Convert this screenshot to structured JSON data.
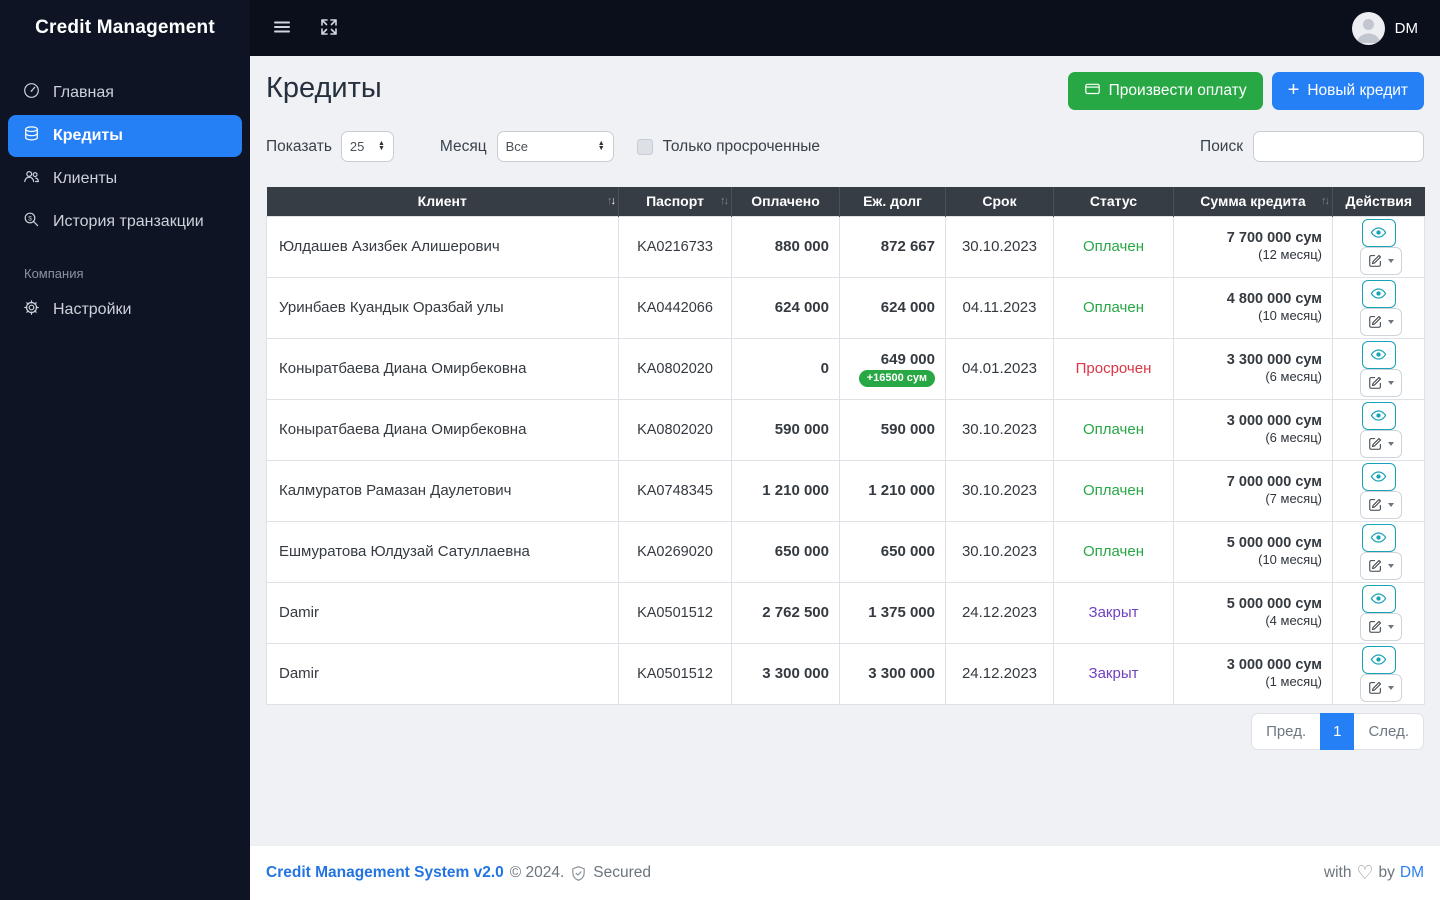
{
  "brand": "Credit Management",
  "topbar": {
    "user_initials": "DM"
  },
  "sidebar": {
    "nav": [
      {
        "label": "Главная",
        "icon": "speedometer-icon",
        "active": false
      },
      {
        "label": "Кредиты",
        "icon": "coins-icon",
        "active": true
      },
      {
        "label": "Клиенты",
        "icon": "users-icon",
        "active": false
      },
      {
        "label": "История транзакции",
        "icon": "transaction-search-icon",
        "active": false
      }
    ],
    "section_label": "Компания",
    "settings_label": "Настройки"
  },
  "page": {
    "title": "Кредиты",
    "pay_button": "Произвести оплату",
    "new_credit_button": "Новый кредит"
  },
  "filters": {
    "show_label": "Показать",
    "show_value": "25",
    "month_label": "Месяц",
    "month_value": "Все",
    "overdue_label": "Только просроченные",
    "overdue_checked": false,
    "search_label": "Поиск",
    "search_value": ""
  },
  "table": {
    "headers": [
      {
        "label": "Клиент",
        "sort": "active"
      },
      {
        "label": "Паспорт",
        "sort": "inactive"
      },
      {
        "label": "Оплачено",
        "sort": null
      },
      {
        "label": "Еж. долг",
        "sort": null
      },
      {
        "label": "Срок",
        "sort": null
      },
      {
        "label": "Статус",
        "sort": null
      },
      {
        "label": "Сумма кредита",
        "sort": "inactive"
      },
      {
        "label": "Действия",
        "sort": null
      }
    ],
    "rows": [
      {
        "client": "Юлдашев Азизбек Алишерович",
        "passport": "KA0216733",
        "paid": "880 000",
        "monthly": "872 667",
        "badge": null,
        "due": "30.10.2023",
        "status": "Оплачен",
        "status_color": "#28a745",
        "amount": "7 700 000 сум",
        "term": "(12 месяц)"
      },
      {
        "client": "Уринбаев Куандык Оразбай улы",
        "passport": "KA0442066",
        "paid": "624 000",
        "monthly": "624 000",
        "badge": null,
        "due": "04.11.2023",
        "status": "Оплачен",
        "status_color": "#28a745",
        "amount": "4 800 000 сум",
        "term": "(10 месяц)"
      },
      {
        "client": "Коныратбаева Диана Омирбековна",
        "passport": "KA0802020",
        "paid": "0",
        "monthly": "649 000",
        "badge": "+16500 сум",
        "due": "04.01.2023",
        "status": "Просрочен",
        "status_color": "#dc3545",
        "amount": "3 300 000 сум",
        "term": "(6 месяц)"
      },
      {
        "client": "Коныратбаева Диана Омирбековна",
        "passport": "KA0802020",
        "paid": "590 000",
        "monthly": "590 000",
        "badge": null,
        "due": "30.10.2023",
        "status": "Оплачен",
        "status_color": "#28a745",
        "amount": "3 000 000 сум",
        "term": "(6 месяц)"
      },
      {
        "client": "Калмуратов Рамазан Даулетович",
        "passport": "KA0748345",
        "paid": "1 210 000",
        "monthly": "1 210 000",
        "badge": null,
        "due": "30.10.2023",
        "status": "Оплачен",
        "status_color": "#28a745",
        "amount": "7 000 000 сум",
        "term": "(7 месяц)"
      },
      {
        "client": "Ешмуратова Юлдузай Сатуллаевна",
        "passport": "KA0269020",
        "paid": "650 000",
        "monthly": "650 000",
        "badge": null,
        "due": "30.10.2023",
        "status": "Оплачен",
        "status_color": "#28a745",
        "amount": "5 000 000 сум",
        "term": "(10 месяц)"
      },
      {
        "client": "Damir",
        "passport": "KA0501512",
        "paid": "2 762 500",
        "monthly": "1 375 000",
        "badge": null,
        "due": "24.12.2023",
        "status": "Закрыт",
        "status_color": "#6f42c1",
        "amount": "5 000 000 сум",
        "term": "(4 месяц)"
      },
      {
        "client": "Damir",
        "passport": "KA0501512",
        "paid": "3 300 000",
        "monthly": "3 300 000",
        "badge": null,
        "due": "24.12.2023",
        "status": "Закрыт",
        "status_color": "#6f42c1",
        "amount": "3 000 000 сум",
        "term": "(1 месяц)"
      }
    ]
  },
  "pagination": {
    "prev_label": "Пред.",
    "current_page": "1",
    "next_label": "След."
  },
  "footer": {
    "brand": "Credit Management System v2.0",
    "copyright": "© 2024.",
    "secured_label": "Secured",
    "with_label": "with",
    "by_label": "by",
    "author": "DM"
  },
  "colors": {
    "primary": "#2680f5",
    "success": "#28a745",
    "danger": "#dc3545",
    "closed": "#6f42c1",
    "info": "#17a2b8",
    "sidebar_bg": "#0e1424",
    "topbar_bg": "#0a0f1b",
    "table_header_bg": "#373d44"
  }
}
